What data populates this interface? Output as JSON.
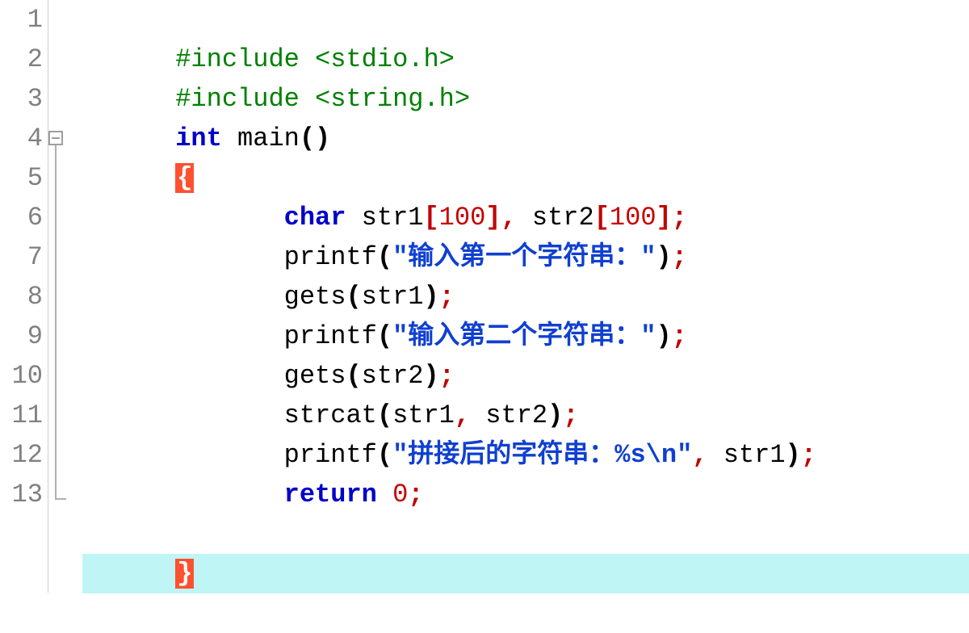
{
  "gutter": {
    "lines": [
      "1",
      "2",
      "3",
      "4",
      "5",
      "6",
      "7",
      "8",
      "9",
      "10",
      "11",
      "12",
      "13"
    ]
  },
  "code": {
    "l1": {
      "inc": "#include ",
      "hdr": "<stdio.h>"
    },
    "l2": {
      "inc": "#include ",
      "hdr": "<string.h>"
    },
    "l3": {
      "kw": "int",
      "sp": " ",
      "fn": "main",
      "lp": "(",
      "rp": ")"
    },
    "l4": {
      "brace": "{"
    },
    "l5": {
      "indent": "       ",
      "type": "char",
      "sp1": " ",
      "id1": "str1",
      "lb1": "[",
      "n1": "100",
      "rb1": "]",
      "c": ",",
      "sp2": " ",
      "id2": "str2",
      "lb2": "[",
      "n2": "100",
      "rb2": "]",
      "semi": ";"
    },
    "l6": {
      "indent": "       ",
      "fn": "printf",
      "lp": "(",
      "str": "\"输入第一个字符串：\"",
      "rp": ")",
      "semi": ";"
    },
    "l7": {
      "indent": "       ",
      "fn": "gets",
      "lp": "(",
      "arg": "str1",
      "rp": ")",
      "semi": ";"
    },
    "l8": {
      "indent": "       ",
      "fn": "printf",
      "lp": "(",
      "str": "\"输入第二个字符串：\"",
      "rp": ")",
      "semi": ";"
    },
    "l9": {
      "indent": "       ",
      "fn": "gets",
      "lp": "(",
      "arg": "str2",
      "rp": ")",
      "semi": ";"
    },
    "l10": {
      "indent": "       ",
      "fn": "strcat",
      "lp": "(",
      "a1": "str1",
      "c": ",",
      "sp": " ",
      "a2": "str2",
      "rp": ")",
      "semi": ";"
    },
    "l11": {
      "indent": "       ",
      "fn": "printf",
      "lp": "(",
      "str": "\"拼接后的字符串：%s\\n\"",
      "c": ",",
      "sp": " ",
      "arg": "str1",
      "rp": ")",
      "semi": ";"
    },
    "l12": {
      "indent": "       ",
      "kw": "return",
      "sp": " ",
      "n": "0",
      "semi": ";"
    },
    "l13": {
      "brace": "}"
    }
  }
}
